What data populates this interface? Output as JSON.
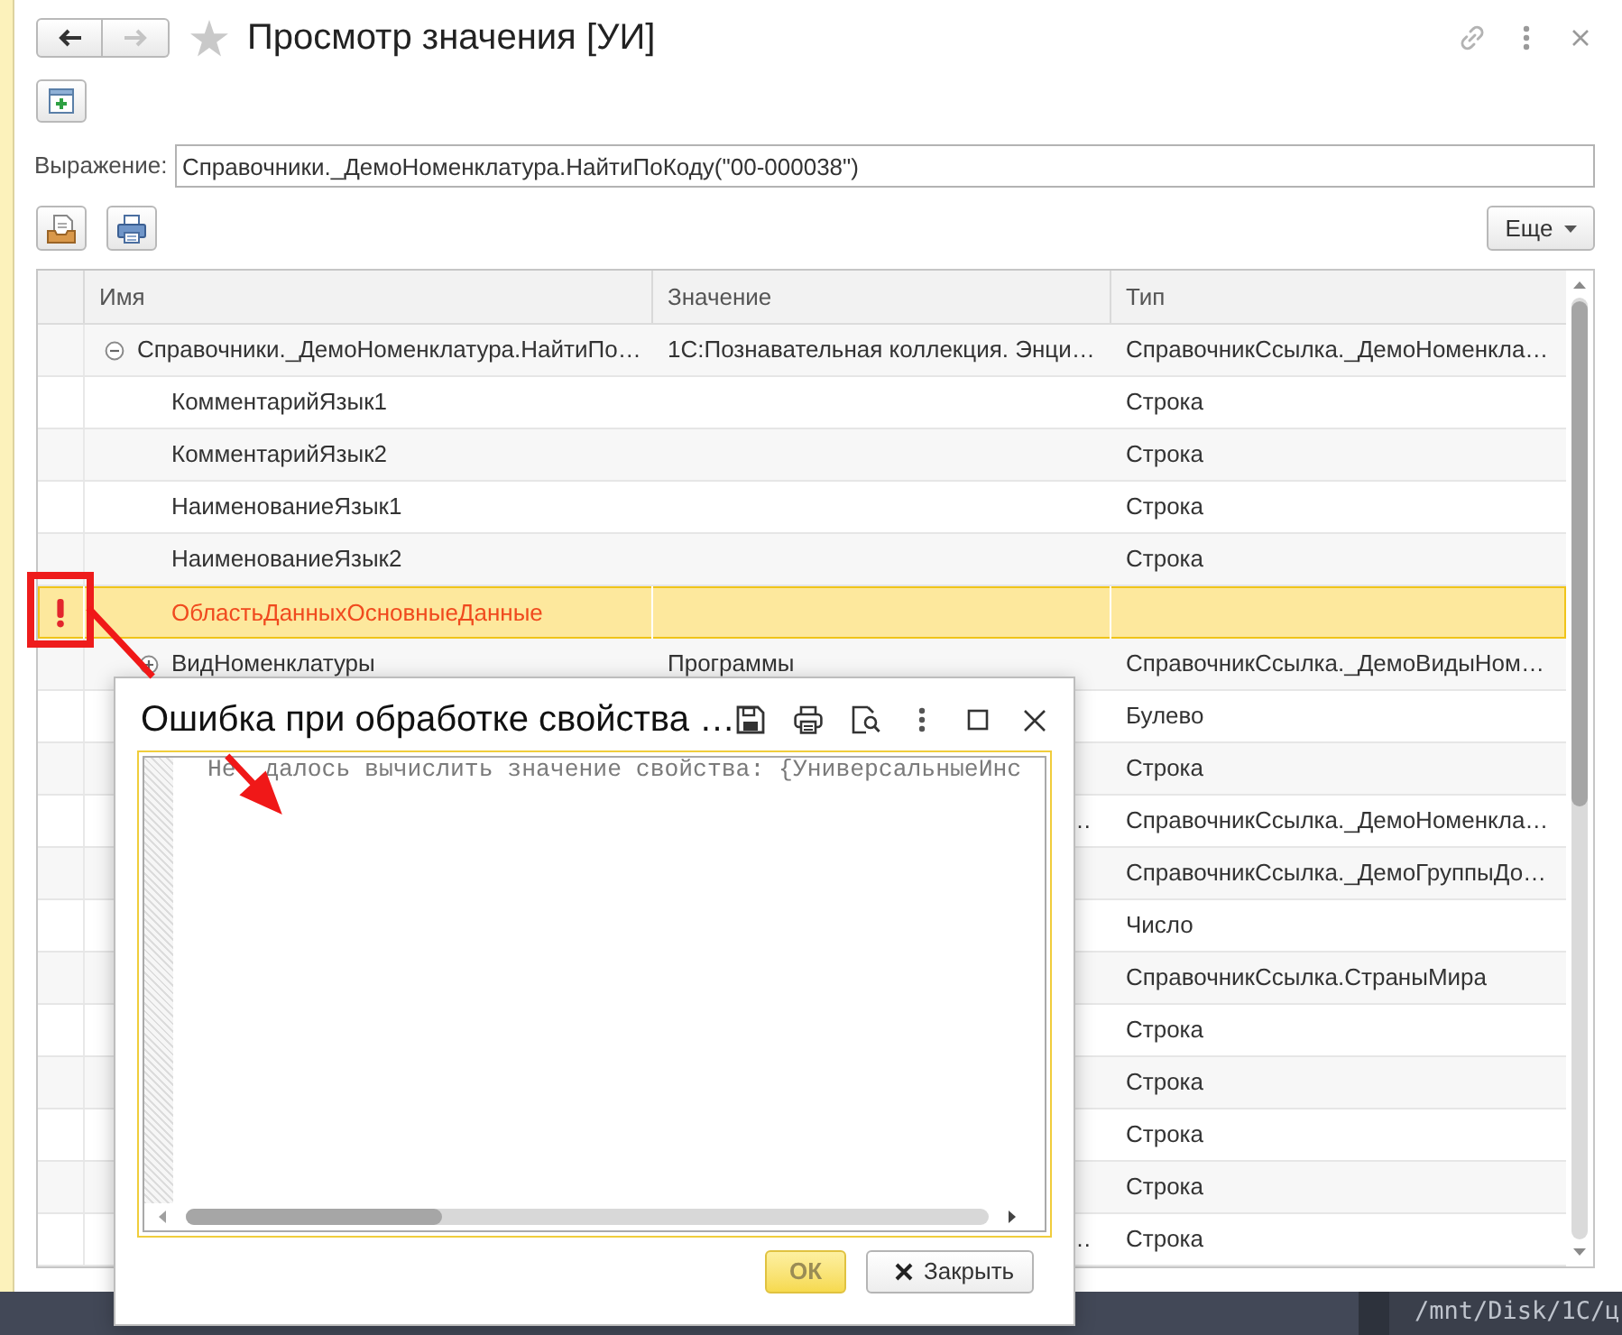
{
  "window": {
    "title": "Просмотр значения [УИ]",
    "starred": false
  },
  "navigation": {
    "back": {
      "disabled": false
    },
    "forward": {
      "disabled": true
    }
  },
  "expression": {
    "label": "Выражение:",
    "value": "Справочники._ДемоНоменклатура.НайтиПоКоду(\"00-000038\")"
  },
  "more_button": {
    "label": "Еще"
  },
  "table": {
    "columns": [
      "Имя",
      "Значение",
      "Тип"
    ],
    "rows": [
      {
        "name": "Справочники._ДемоНоменклатура.НайтиПо…",
        "value": "1С:Познавательная коллекция. Энци…",
        "type": "СправочникСсылка._ДемоНоменкла…",
        "expanded": true,
        "selected": false,
        "error": false,
        "children": [
          {
            "name": "КомментарийЯзык1",
            "type": "Строка",
            "selected": false,
            "error": false
          },
          {
            "name": "КомментарийЯзык2",
            "type": "Строка",
            "selected": false,
            "error": false
          },
          {
            "name": "НаименованиеЯзык1",
            "type": "Строка",
            "selected": false,
            "error": false
          },
          {
            "name": "НаименованиеЯзык2",
            "type": "Строка",
            "selected": false,
            "error": false
          },
          {
            "name": "ОбластьДанныхОсновныеДанные",
            "selected": true,
            "error": true
          },
          {
            "name": "ВидНоменклатуры",
            "value": "Программы",
            "type": "СправочникСсылка._ДемоВидыНом…",
            "expanded": false,
            "selected": false,
            "error": false
          },
          {
            "type": "Булево",
            "selected": false,
            "error": false
          },
          {
            "type": "Строка",
            "selected": false,
            "error": false
          },
          {
            "value_tail": "…",
            "type": "СправочникСсылка._ДемоНоменкла…",
            "selected": false,
            "error": false
          },
          {
            "type": "СправочникСсылка._ДемоГруппыДо…",
            "selected": false,
            "error": false
          },
          {
            "type": "Число",
            "selected": false,
            "error": false
          },
          {
            "type": "СправочникСсылка.СтраныМира",
            "selected": false,
            "error": false
          },
          {
            "type": "Строка",
            "selected": false,
            "error": false
          },
          {
            "type": "Строка",
            "selected": false,
            "error": false
          },
          {
            "type": "Строка",
            "selected": false,
            "error": false
          },
          {
            "type": "Строка",
            "selected": false,
            "error": false
          },
          {
            "value_tail": "…",
            "type": "Строка",
            "selected": false,
            "error": false
          }
        ]
      }
    ]
  },
  "dialog": {
    "title": "Ошибка при обработке свойства …",
    "text_parts": [
      "Не",
      "далось вычислить значение свойства: {УниверсальныеИнс"
    ],
    "buttons": [
      {
        "label": "ОК",
        "kind": "default"
      },
      {
        "label": "Закрыть",
        "kind": "close"
      }
    ]
  },
  "taskbar": {
    "text": "/mnt/Disk/1C/ц"
  }
}
